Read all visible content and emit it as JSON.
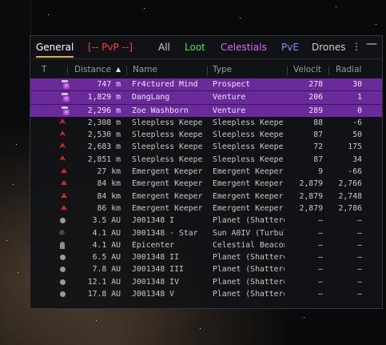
{
  "tabs": [
    "General",
    "[-- PvP --]",
    "All",
    "Loot",
    "Celestials",
    "PvE",
    "Drones"
  ],
  "controls": {
    "menu": "⋮",
    "minimize": "—"
  },
  "columns": {
    "type": "T",
    "distance": "Distance",
    "sort_indicator": "▲",
    "name": "Name",
    "type_col": "Type",
    "velocity": "Velocit",
    "radial": "Radial"
  },
  "colors": {
    "selected_row": "#6b2a9a",
    "hostile_icon": "#d42428",
    "tab_underline": "#d9b04a"
  },
  "rows": [
    {
      "icon": "ship-fleet-icon",
      "distance": "747 m",
      "name": "Fr4ctured Mind",
      "type": "Prospect",
      "velocity": "278",
      "radial": "30",
      "selected": true
    },
    {
      "icon": "ship-fleet-icon",
      "distance": "1,829 m",
      "name": "DangLang",
      "type": "Venture",
      "velocity": "206",
      "radial": "1",
      "selected": true
    },
    {
      "icon": "ship-fleet-icon",
      "distance": "2,296 m",
      "name": "Zoe Washborn",
      "type": "Venture",
      "velocity": "289",
      "radial": "0",
      "selected": true
    },
    {
      "icon": "npc-chevron-icon",
      "distance": "2,308 m",
      "name": "Sleepless Keepe",
      "type": "Sleepless Keepe",
      "velocity": "88",
      "radial": "-6",
      "selected": false
    },
    {
      "icon": "npc-chevron-icon",
      "distance": "2,530 m",
      "name": "Sleepless Keepe",
      "type": "Sleepless Keepe",
      "velocity": "87",
      "radial": "50",
      "selected": false
    },
    {
      "icon": "npc-chevron-icon",
      "distance": "2,683 m",
      "name": "Sleepless Keepe",
      "type": "Sleepless Keepe",
      "velocity": "72",
      "radial": "175",
      "selected": false
    },
    {
      "icon": "npc-chevron-icon",
      "distance": "2,851 m",
      "name": "Sleepless Keepe",
      "type": "Sleepless Keepe",
      "velocity": "87",
      "radial": "34",
      "selected": false
    },
    {
      "icon": "npc-triangle-icon",
      "distance": "27 km",
      "name": "Emergent Keeper",
      "type": "Emergent Keeper",
      "velocity": "9",
      "radial": "-66",
      "selected": false
    },
    {
      "icon": "npc-triangle-icon",
      "distance": "84 km",
      "name": "Emergent Keeper",
      "type": "Emergent Keeper",
      "velocity": "2,879",
      "radial": "2,766",
      "selected": false
    },
    {
      "icon": "npc-triangle-icon",
      "distance": "84 km",
      "name": "Emergent Keeper",
      "type": "Emergent Keeper",
      "velocity": "2,879",
      "radial": "2,748",
      "selected": false
    },
    {
      "icon": "npc-triangle-icon",
      "distance": "86 km",
      "name": "Emergent Keeper",
      "type": "Emergent Keeper",
      "velocity": "2,879",
      "radial": "2,786",
      "selected": false
    },
    {
      "icon": "planet-icon",
      "distance": "3.5 AU",
      "name": "J001348 I",
      "type": "Planet (Shattere",
      "velocity": "–",
      "radial": "–",
      "selected": false
    },
    {
      "icon": "sun-icon",
      "distance": "4.1 AU",
      "name": "J001348 - Star",
      "type": "Sun A0IV (Turbul",
      "velocity": "–",
      "radial": "–",
      "selected": false
    },
    {
      "icon": "beacon-icon",
      "distance": "4.1 AU",
      "name": "Epicenter",
      "type": "Celestial Beacon",
      "velocity": "–",
      "radial": "–",
      "selected": false
    },
    {
      "icon": "planet-icon",
      "distance": "6.5 AU",
      "name": "J001348 II",
      "type": "Planet (Shattere",
      "velocity": "–",
      "radial": "–",
      "selected": false
    },
    {
      "icon": "planet-icon",
      "distance": "7.8 AU",
      "name": "J001348 III",
      "type": "Planet (Shattere",
      "velocity": "–",
      "radial": "–",
      "selected": false
    },
    {
      "icon": "planet-icon",
      "distance": "12.1 AU",
      "name": "J001348 IV",
      "type": "Planet (Shattere",
      "velocity": "–",
      "radial": "–",
      "selected": false
    },
    {
      "icon": "planet-icon",
      "distance": "17.8 AU",
      "name": "J001348 V",
      "type": "Planet (Shattere",
      "velocity": "–",
      "radial": "–",
      "selected": false
    }
  ]
}
